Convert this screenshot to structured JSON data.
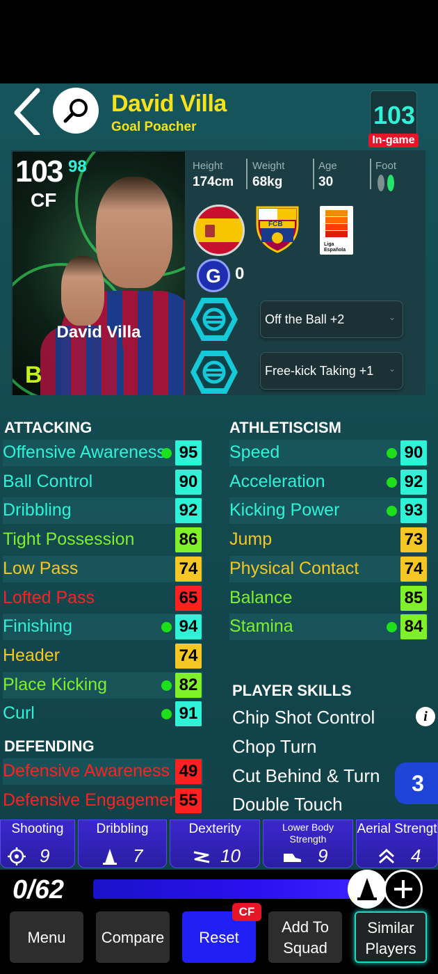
{
  "header": {
    "title": "David Villa",
    "subtitle": "Goal Poacher",
    "rating": "103",
    "rating_tag": "In-game"
  },
  "card": {
    "overall": "103",
    "potential": "98",
    "position": "CF",
    "name": "David Villa",
    "grade": "B"
  },
  "info": {
    "height_label": "Height",
    "height": "174cm",
    "weight_label": "Weight",
    "weight": "68kg",
    "age_label": "Age",
    "age": "30",
    "foot_label": "Foot"
  },
  "club": {
    "crest_text": "FCB",
    "league_text": "Liga Española"
  },
  "g_points": {
    "letter": "G",
    "count": "0"
  },
  "boosters": [
    {
      "label": "Off the Ball +2"
    },
    {
      "label": "Free-kick Taking +1"
    }
  ],
  "attacking": {
    "title": "ATTACKING",
    "stats": [
      {
        "name": "Offensive Awareness",
        "value": "95",
        "boost": true,
        "color": "#2ff2d6"
      },
      {
        "name": "Ball Control",
        "value": "90",
        "boost": false,
        "color": "#2ff2d6"
      },
      {
        "name": "Dribbling",
        "value": "92",
        "boost": false,
        "color": "#2ff2d6"
      },
      {
        "name": "Tight Possession",
        "value": "86",
        "boost": false,
        "color": "#7ff02a"
      },
      {
        "name": "Low Pass",
        "value": "74",
        "boost": false,
        "color": "#f5c723"
      },
      {
        "name": "Lofted Pass",
        "value": "65",
        "boost": false,
        "color": "#ff2121"
      },
      {
        "name": "Finishing",
        "value": "94",
        "boost": true,
        "color": "#2ff2d6"
      },
      {
        "name": "Header",
        "value": "74",
        "boost": false,
        "color": "#f5c723"
      },
      {
        "name": "Place Kicking",
        "value": "82",
        "boost": true,
        "color": "#7ff02a"
      },
      {
        "name": "Curl",
        "value": "91",
        "boost": true,
        "color": "#2ff2d6"
      }
    ]
  },
  "defending": {
    "title": "DEFENDING",
    "stats": [
      {
        "name": "Defensive Awareness",
        "value": "49",
        "color": "#ff2121"
      },
      {
        "name": "Defensive Engagement",
        "value": "55",
        "color": "#ff2121"
      }
    ]
  },
  "athleticism": {
    "title": "ATHLETISCISM",
    "stats": [
      {
        "name": "Speed",
        "value": "90",
        "boost": true,
        "color": "#2ff2d6"
      },
      {
        "name": "Acceleration",
        "value": "92",
        "boost": true,
        "color": "#2ff2d6"
      },
      {
        "name": "Kicking Power",
        "value": "93",
        "boost": true,
        "color": "#2ff2d6"
      },
      {
        "name": "Jump",
        "value": "73",
        "boost": false,
        "color": "#f5c723"
      },
      {
        "name": "Physical Contact",
        "value": "74",
        "boost": false,
        "color": "#f5c723"
      },
      {
        "name": "Balance",
        "value": "85",
        "boost": false,
        "color": "#7ff02a"
      },
      {
        "name": "Stamina",
        "value": "84",
        "boost": true,
        "color": "#7ff02a"
      }
    ]
  },
  "skills": {
    "title": "PLAYER SKILLS",
    "items": [
      "Chip Shot Control",
      "Chop Turn",
      "Cut Behind & Turn",
      "Double Touch"
    ],
    "count": "3",
    "info_glyph": "i"
  },
  "training_tabs": [
    {
      "label": "Shooting",
      "value": "9",
      "icon": "crosshair-icon"
    },
    {
      "label": "Dribbling",
      "value": "7",
      "icon": "cone-icon"
    },
    {
      "label": "Dexterity",
      "value": "10",
      "icon": "zigzag-icon"
    },
    {
      "label_line1": "Lower Body",
      "label_line2": "Strength",
      "value": "9",
      "icon": "boot-icon"
    },
    {
      "label": "Aerial Strengt",
      "value": "4",
      "icon": "double-chevron-up-icon"
    }
  ],
  "progress": {
    "points": "0/62"
  },
  "buttons": {
    "menu": "Menu",
    "compare": "Compare",
    "reset": "Reset",
    "reset_badge": "CF",
    "add_line1": "Add To",
    "add_line2": "Squad",
    "similar_line1": "Similar",
    "similar_line2": "Players"
  }
}
